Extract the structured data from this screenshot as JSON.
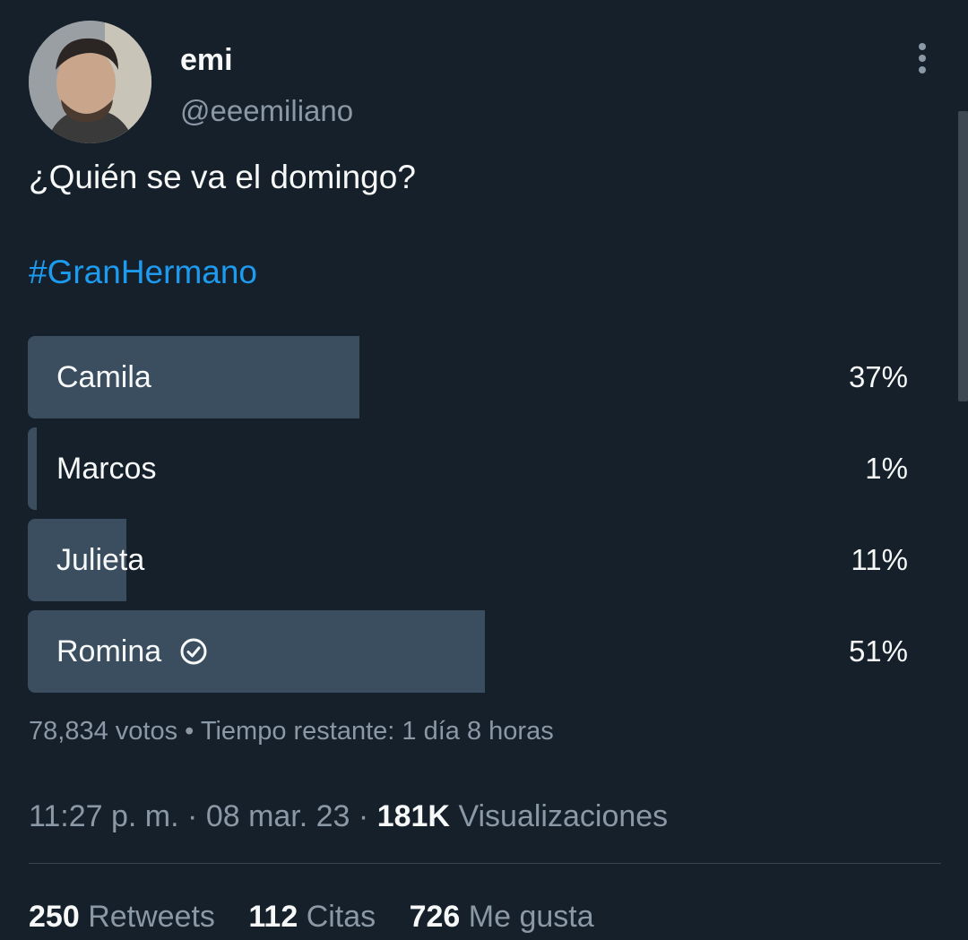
{
  "author": {
    "display_name": "emi",
    "handle": "@eeemiliano"
  },
  "tweet": {
    "text": "¿Quién se va el domingo?",
    "hashtag": "#GranHermano"
  },
  "poll": {
    "options": [
      {
        "label": "Camila",
        "percent_text": "37%",
        "fraction": 0.37,
        "winner": false
      },
      {
        "label": "Marcos",
        "percent_text": "1%",
        "fraction": 0.01,
        "winner": false
      },
      {
        "label": "Julieta",
        "percent_text": "11%",
        "fraction": 0.11,
        "winner": false
      },
      {
        "label": "Romina",
        "percent_text": "51%",
        "fraction": 0.51,
        "winner": true
      }
    ],
    "votes": "78,834 votos",
    "separator": "•",
    "time_remaining": "Tiempo restante: 1 día 8 horas"
  },
  "meta": {
    "time": "11:27 p. m.",
    "date": "08 mar. 23",
    "dot": "·",
    "views_count": "181K",
    "views_label": "Visualizaciones"
  },
  "stats": {
    "retweets_count": "250",
    "retweets_label": "Retweets",
    "quotes_count": "112",
    "quotes_label": "Citas",
    "likes_count": "726",
    "likes_label": "Me gusta"
  },
  "colors": {
    "background": "#15202b",
    "poll_bar": "#3b4e60",
    "link": "#1d9bf0",
    "secondary_text": "#8b98a5"
  },
  "icons": {
    "more": "more-vertical-icon",
    "winner_check": "check-circle-icon"
  }
}
